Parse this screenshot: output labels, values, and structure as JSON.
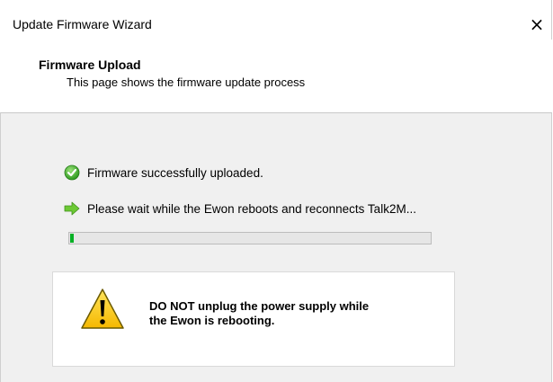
{
  "window": {
    "title": "Update Firmware Wizard",
    "close_symbol": "×"
  },
  "header": {
    "title": "Firmware Upload",
    "subtitle": "This page shows the firmware update process"
  },
  "status": {
    "uploaded": "Firmware successfully uploaded.",
    "wait": "Please wait while the Ewon reboots and reconnects Talk2M..."
  },
  "progress": {
    "percent": 1
  },
  "warning": {
    "line1": "DO NOT unplug the power supply while",
    "line2": "the Ewon is rebooting."
  },
  "icons": {
    "success": "check-circle-icon",
    "arrow": "arrow-right-icon",
    "warning": "warning-triangle-icon",
    "close": "close-icon"
  },
  "colors": {
    "progress_fill": "#06b025",
    "success_green": "#3aa829",
    "arrow_green": "#5cbd2a",
    "warning_yellow": "#ffd100"
  }
}
